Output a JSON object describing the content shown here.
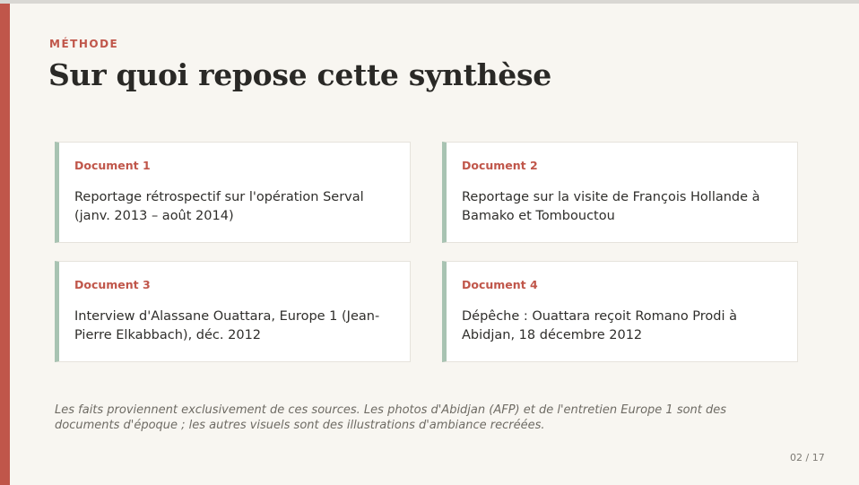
{
  "slide": {
    "eyebrow": "MÉTHODE",
    "title": "Sur quoi repose cette synthèse",
    "accent_color": "#c0564a",
    "card_border_color": "#a8c3b2"
  },
  "documents": [
    {
      "label": "Document 1",
      "text": "Reportage rétrospectif sur l'opération Serval (janv. 2013 – août 2014)"
    },
    {
      "label": "Document 2",
      "text": "Reportage sur la visite de François Hollande à Bamako et Tombouctou"
    },
    {
      "label": "Document 3",
      "text": "Interview d'Alassane Ouattara, Europe 1 (Jean-Pierre Elkabbach), déc. 2012"
    },
    {
      "label": "Document 4",
      "text": "Dépêche : Ouattara reçoit Romano Prodi à Abidjan, 18 décembre 2012"
    }
  ],
  "footer": {
    "note": "Les faits proviennent exclusivement de ces sources. Les photos d'Abidjan (AFP) et de l'entretien Europe 1 sont des documents d'époque ; les autres visuels sont des illustrations d'ambiance recréées.",
    "page": "02 / 17"
  }
}
